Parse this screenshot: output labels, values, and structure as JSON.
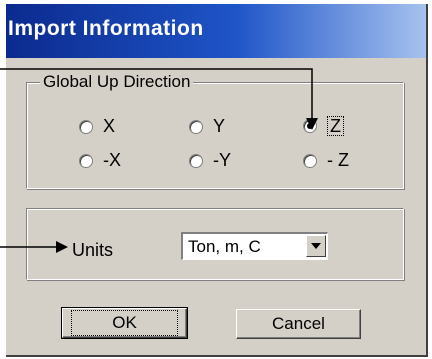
{
  "dialog": {
    "title": "Import Information"
  },
  "global_up": {
    "caption": "Global Up Direction",
    "options": [
      {
        "label": "X",
        "selected": false
      },
      {
        "label": "Y",
        "selected": false
      },
      {
        "label": "Z",
        "selected": true
      },
      {
        "label": "-X",
        "selected": false
      },
      {
        "label": "-Y",
        "selected": false
      },
      {
        "label": "- Z",
        "selected": false
      }
    ]
  },
  "units": {
    "label": "Units",
    "value": "Ton, m, C"
  },
  "buttons": {
    "ok": "OK",
    "cancel": "Cancel"
  }
}
